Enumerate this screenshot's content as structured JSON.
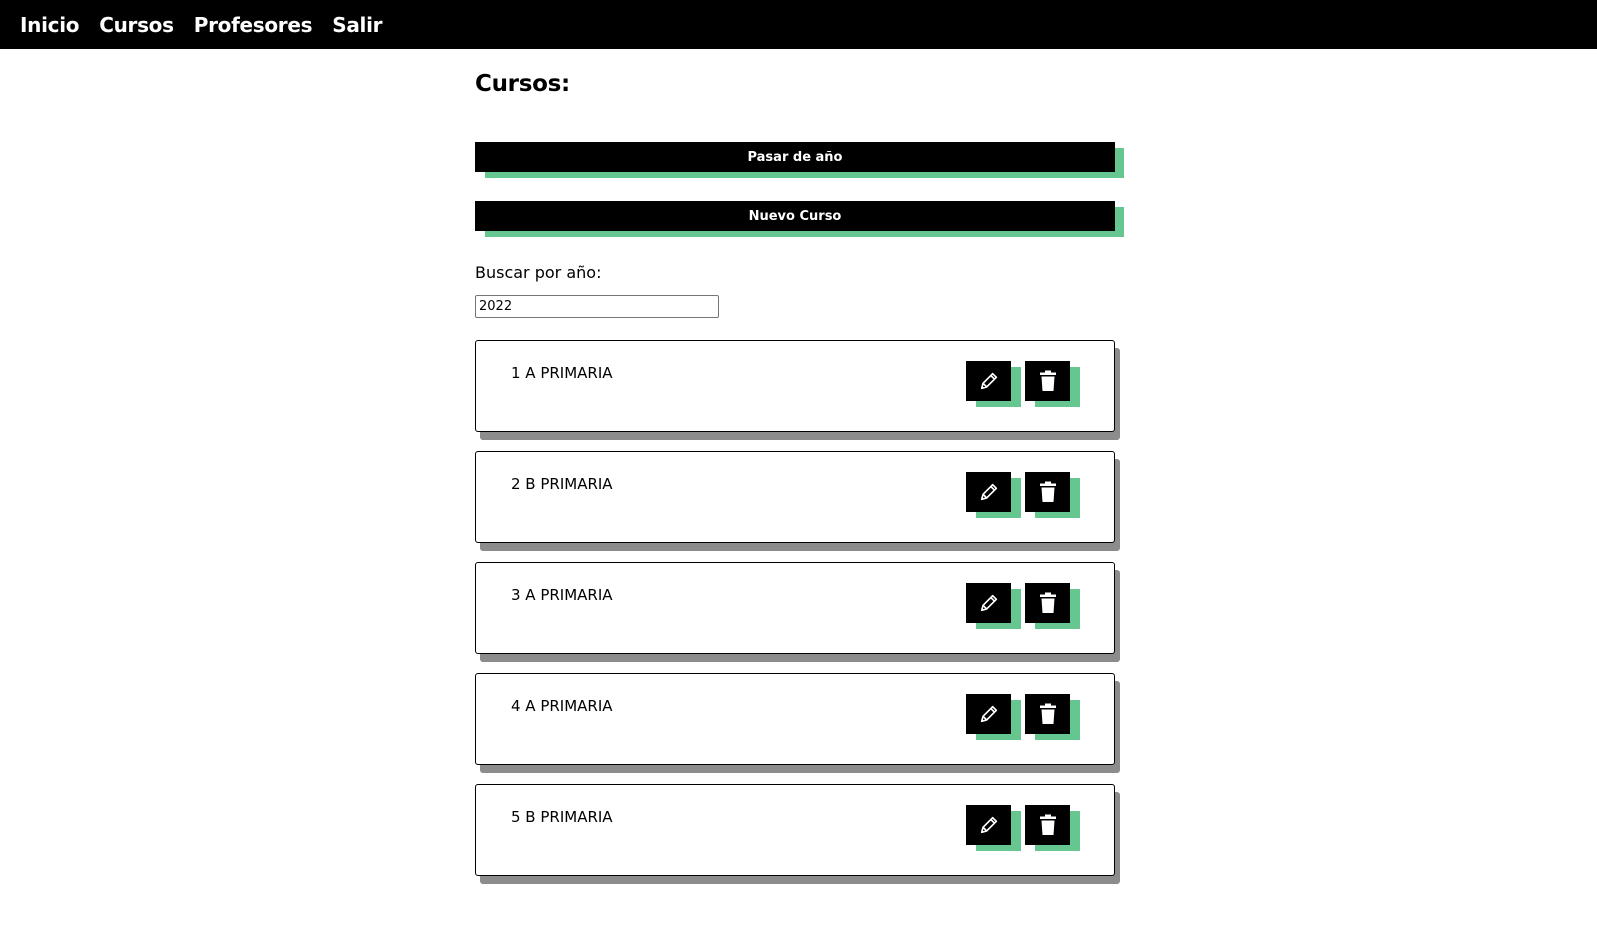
{
  "nav": {
    "items": [
      "Inicio",
      "Cursos",
      "Profesores",
      "Salir"
    ]
  },
  "page": {
    "title": "Cursos:"
  },
  "actions": {
    "pass_year_label": "Pasar de año",
    "new_course_label": "Nuevo Curso"
  },
  "search": {
    "label": "Buscar por año:",
    "value": "2022"
  },
  "courses": [
    {
      "name": "1 A PRIMARIA",
      "edit_icon": "pencil-icon",
      "delete_icon": "trash-icon"
    },
    {
      "name": "2 B PRIMARIA",
      "edit_icon": "pencil-icon",
      "delete_icon": "trash-icon"
    },
    {
      "name": "3 A PRIMARIA",
      "edit_icon": "pencil-icon",
      "delete_icon": "trash-icon"
    },
    {
      "name": "4 A PRIMARIA",
      "edit_icon": "pencil-icon",
      "delete_icon": "trash-icon"
    },
    {
      "name": "5 B PRIMARIA",
      "edit_icon": "pencil-icon",
      "delete_icon": "trash-icon"
    }
  ],
  "colors": {
    "nav_bg": "#000000",
    "accent_shadow": "#66c68f",
    "card_shadow": "#8c8c8c"
  }
}
